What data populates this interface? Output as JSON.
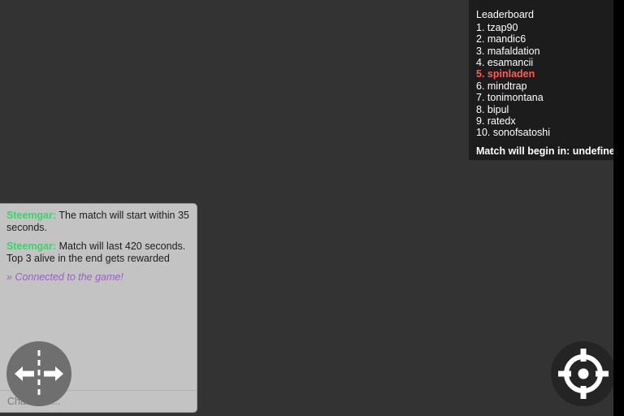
{
  "leaderboard": {
    "title": "Leaderboard",
    "entries": [
      {
        "rank": "1.",
        "name": "tzap90",
        "label": "1. tzap90",
        "highlight": false
      },
      {
        "rank": "2.",
        "name": "mandic6",
        "label": "2. mandic6",
        "highlight": false
      },
      {
        "rank": "3.",
        "name": "mafaldation",
        "label": "3. mafaldation",
        "highlight": false
      },
      {
        "rank": "4.",
        "name": "esamancii",
        "label": "4. esamancii",
        "highlight": false
      },
      {
        "rank": "5.",
        "name": "spinladen",
        "label": "5. spinladen",
        "highlight": true
      },
      {
        "rank": "6.",
        "name": "mindtrap",
        "label": "6. mindtrap",
        "highlight": false
      },
      {
        "rank": "7.",
        "name": "tonimontana",
        "label": "7. tonimontana",
        "highlight": false
      },
      {
        "rank": "8.",
        "name": "bipul",
        "label": "8. bipul",
        "highlight": false
      },
      {
        "rank": "9.",
        "name": "ratedx",
        "label": "9. ratedx",
        "highlight": false
      },
      {
        "rank": "10.",
        "name": "sonofsatoshi",
        "label": "10. sonofsatoshi",
        "highlight": false
      }
    ],
    "timer_text": "Match will begin in: undefined",
    "highlight_color": "#ff5b5b",
    "panel_color": "#1c1c1c"
  },
  "chat": {
    "messages": [
      {
        "author": "Steemgar",
        "author_suffix": ":",
        "text": " The match will start within 35 seconds.",
        "type": "user"
      },
      {
        "author": "Steemgar",
        "author_suffix": ":",
        "text": " Match will last 420 seconds. Top 3 alive in the end gets rewarded",
        "type": "user"
      },
      {
        "author": "",
        "author_suffix": "",
        "text": "» Connected to the game!",
        "type": "system"
      }
    ],
    "input_value": "",
    "input_placeholder": "Chat here...",
    "author_color": "#3fd16b",
    "system_color": "#9b5fc0",
    "panel_color": "#c3c3c3"
  },
  "controls": {
    "move_pad": {
      "name": "move-left-right-pad",
      "left_icon": "arrow-left-icon",
      "right_icon": "arrow-right-icon",
      "color": "#6f6f6f"
    },
    "fire_button": {
      "name": "crosshair-target-button",
      "icon": "crosshair-icon",
      "color": "#242424"
    }
  },
  "stage": {
    "background_color": "#333333",
    "gutter_color": "#000000"
  }
}
